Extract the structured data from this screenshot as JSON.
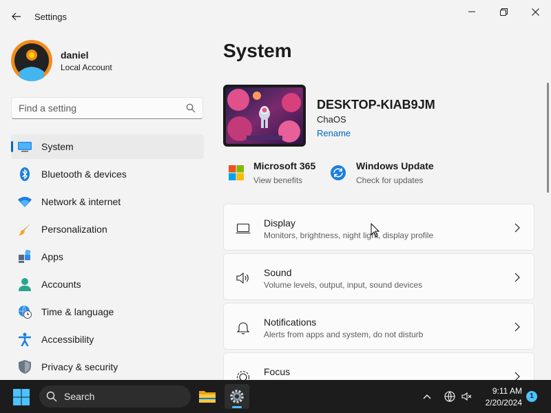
{
  "window": {
    "title": "Settings",
    "controls": [
      "minimize",
      "maximize",
      "close"
    ]
  },
  "profile": {
    "name": "daniel",
    "account_type": "Local Account"
  },
  "search": {
    "placeholder": "Find a setting"
  },
  "sidebar": {
    "items": [
      {
        "label": "System",
        "icon": "system-icon",
        "active": true
      },
      {
        "label": "Bluetooth & devices",
        "icon": "bluetooth-icon"
      },
      {
        "label": "Network & internet",
        "icon": "wifi-icon"
      },
      {
        "label": "Personalization",
        "icon": "brush-icon"
      },
      {
        "label": "Apps",
        "icon": "apps-icon"
      },
      {
        "label": "Accounts",
        "icon": "accounts-icon"
      },
      {
        "label": "Time & language",
        "icon": "globe-clock-icon"
      },
      {
        "label": "Accessibility",
        "icon": "accessibility-icon"
      },
      {
        "label": "Privacy & security",
        "icon": "shield-icon"
      }
    ]
  },
  "main": {
    "title": "System",
    "device": {
      "name": "DESKTOP-KIAB9JM",
      "os": "ChaOS",
      "rename_label": "Rename"
    },
    "quick_links": [
      {
        "title": "Microsoft 365",
        "subtitle": "View benefits",
        "icon": "microsoft365-icon"
      },
      {
        "title": "Windows Update",
        "subtitle": "Check for updates",
        "icon": "windows-update-icon"
      }
    ],
    "cards": [
      {
        "title": "Display",
        "subtitle": "Monitors, brightness, night light, display profile",
        "icon": "display-icon"
      },
      {
        "title": "Sound",
        "subtitle": "Volume levels, output, input, sound devices",
        "icon": "speaker-icon"
      },
      {
        "title": "Notifications",
        "subtitle": "Alerts from apps and system, do not disturb",
        "icon": "bell-icon"
      },
      {
        "title": "Focus",
        "subtitle": "",
        "icon": "focus-icon"
      }
    ]
  },
  "taskbar": {
    "search_label": "Search",
    "time": "9:11 AM",
    "date": "2/20/2024",
    "notification_count": "1"
  },
  "colors": {
    "accent": "#0067c0",
    "taskbar_bg": "#1c1c1c",
    "window_bg": "#f3f3f3",
    "card_bg": "#fbfbfb"
  }
}
